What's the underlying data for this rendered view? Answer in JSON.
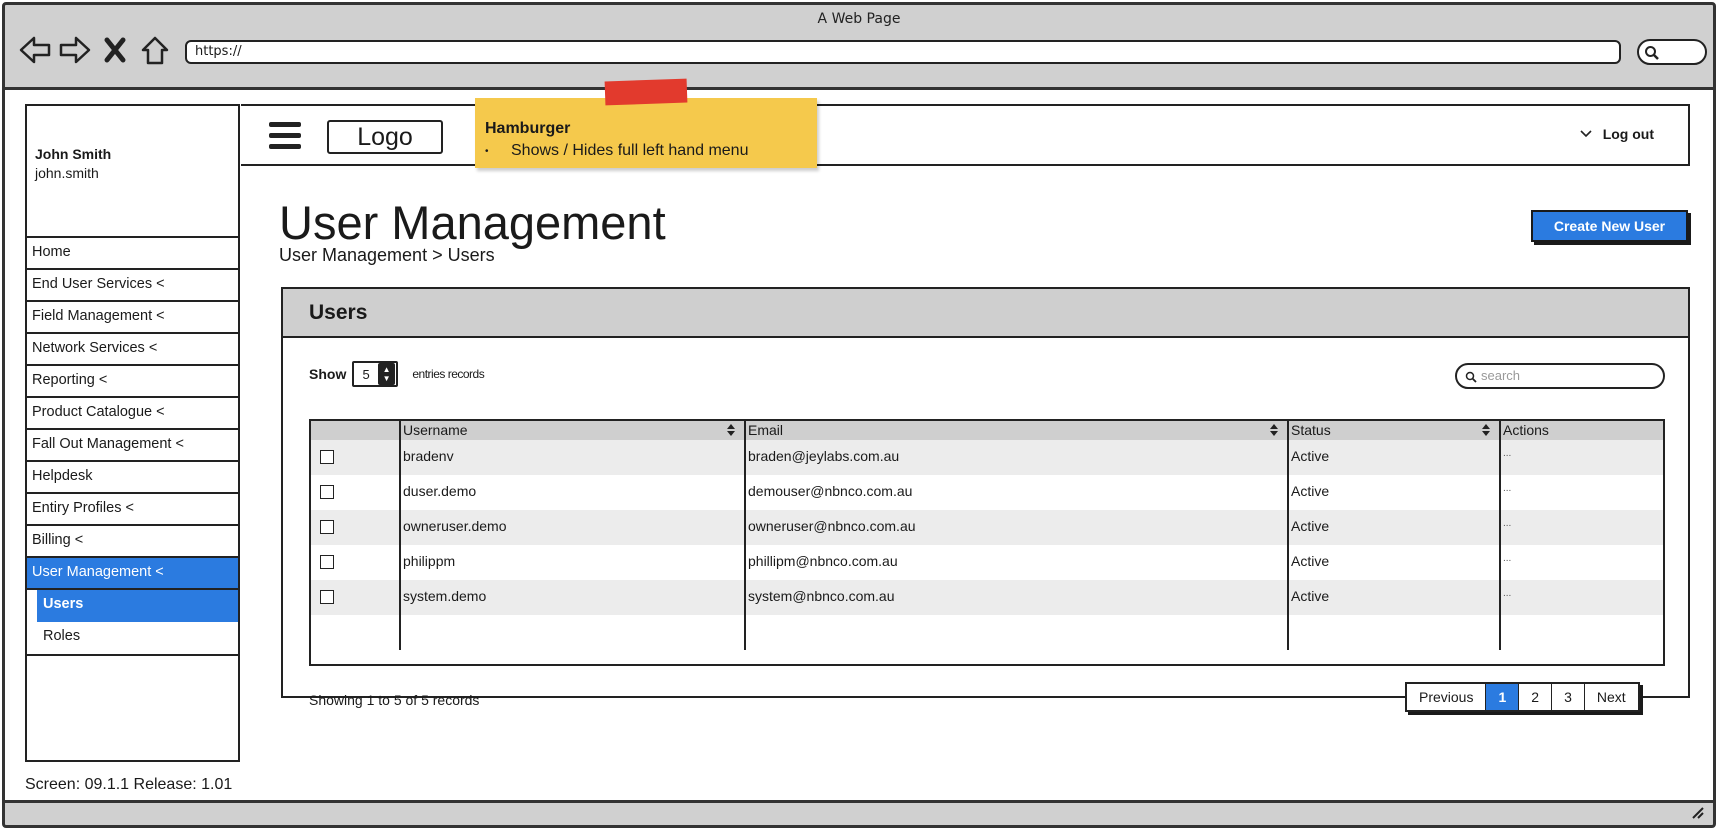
{
  "browser": {
    "title": "A Web Page",
    "url": "https://"
  },
  "sidebar": {
    "user_name": "John Smith",
    "user_login": "john.smith",
    "items": [
      {
        "label": "Home",
        "active": false
      },
      {
        "label": "End User Services <",
        "active": false
      },
      {
        "label": "Field Management <",
        "active": false
      },
      {
        "label": "Network Services <",
        "active": false
      },
      {
        "label": "Reporting <",
        "active": false
      },
      {
        "label": "Product Catalogue <",
        "active": false
      },
      {
        "label": "Fall Out Management <",
        "active": false
      },
      {
        "label": "Helpdesk",
        "active": false
      },
      {
        "label": "Entiry Profiles <",
        "active": false
      },
      {
        "label": "Billing <",
        "active": false
      },
      {
        "label": "User Management <",
        "active": true
      }
    ],
    "subitems": [
      {
        "label": "Users",
        "active": true
      },
      {
        "label": "Roles",
        "active": false
      }
    ]
  },
  "footer": {
    "screen_info": "Screen: 09.1.1  Release: 1.01"
  },
  "header": {
    "logo": "Logo",
    "logout": "Log out"
  },
  "note": {
    "title": "Hamburger",
    "bullet": "Shows / Hides full left hand menu"
  },
  "page": {
    "title": "User Management",
    "breadcrumb": "User Management > Users",
    "create_button": "Create New User"
  },
  "panel": {
    "title": "Users",
    "show_label": "Show",
    "page_size": "5",
    "records_label": "entries records",
    "search_placeholder": "search",
    "columns": [
      "",
      "Username",
      "Email",
      "Status",
      "Actions"
    ],
    "rows": [
      {
        "username": "bradenv",
        "email": "braden@jeylabs.com.au",
        "status": "Active",
        "actions": "..."
      },
      {
        "username": "duser.demo",
        "email": "demouser@nbnco.com.au",
        "status": "Active",
        "actions": "..."
      },
      {
        "username": "owneruser.demo",
        "email": "owneruser@nbnco.com.au",
        "status": "Active",
        "actions": "..."
      },
      {
        "username": "philippm",
        "email": "phillipm@nbnco.com.au",
        "status": "Active",
        "actions": "..."
      },
      {
        "username": "system.demo",
        "email": "system@nbnco.com.au",
        "status": "Active",
        "actions": "..."
      }
    ],
    "summary": "Showing 1 to 5 of 5 records",
    "pagination": {
      "previous": "Previous",
      "pages": [
        "1",
        "2",
        "3"
      ],
      "current": "1",
      "next": "Next"
    }
  },
  "colors": {
    "accent": "#2b7be0",
    "note": "#f5c94c",
    "tape": "#e23a2d",
    "frame": "#d0d0d0"
  }
}
